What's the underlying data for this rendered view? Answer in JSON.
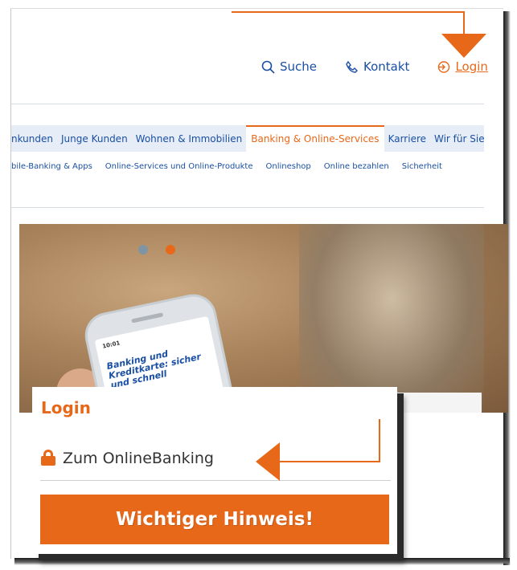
{
  "colors": {
    "accent": "#e8681a",
    "link": "#1a4fa3",
    "nav_bg": "#e6edf7"
  },
  "topnav": {
    "search_label": "Suche",
    "search_icon": "search-icon",
    "contact_label": "Kontakt",
    "contact_icon": "phone-icon",
    "login_label": "Login",
    "login_icon": "login-icon"
  },
  "mainnav": {
    "items": [
      "nkunden",
      "Junge Kunden",
      "Wohnen & Immobilien",
      "Banking & Online-Services",
      "Karriere",
      "Wir für Sie"
    ],
    "active_index": 3
  },
  "subnav": {
    "items": [
      "bile-Banking & Apps",
      "Online-Services und Online-Produkte",
      "Onlineshop",
      "Online bezahlen",
      "Sicherheit"
    ]
  },
  "hero": {
    "phone_time": "10:01",
    "phone_text": "Banking und Kreditkarte: sicher und schnell",
    "slider_dots": 2,
    "active_dot": 1
  },
  "popup": {
    "title": "Login",
    "online_banking_label": "Zum OnlineBanking",
    "lock_icon": "lock-icon",
    "hinweis_button": "Wichtiger Hinweis!"
  }
}
